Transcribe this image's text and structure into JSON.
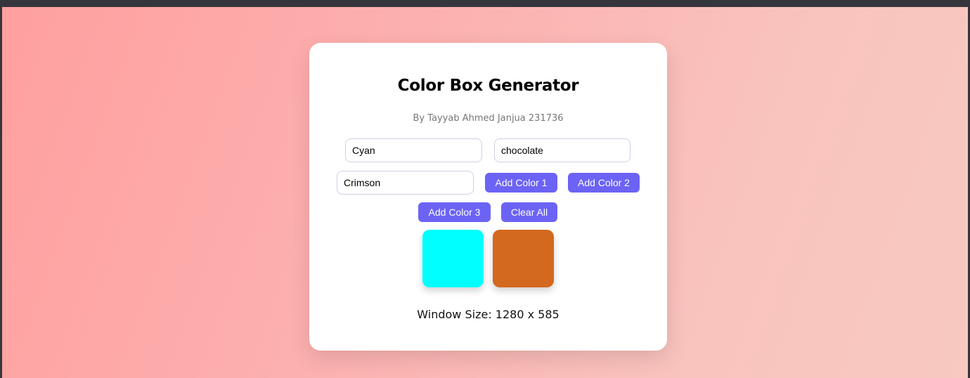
{
  "app": {
    "title": "Color Box Generator",
    "subtitle": "By Tayyab Ahmed Janjua 231736"
  },
  "inputs": {
    "color1_value": "Cyan",
    "color2_value": "chocolate",
    "color3_value": "Crimson"
  },
  "buttons": {
    "add_color_1": "Add Color 1",
    "add_color_2": "Add Color 2",
    "add_color_3": "Add Color 3",
    "clear_all": "Clear All"
  },
  "boxes": [
    {
      "color": "#00ffff"
    },
    {
      "color": "#d2691e"
    }
  ],
  "status": {
    "window_size": "Window Size: 1280 x 585"
  },
  "theme": {
    "accent": "#6c63f5",
    "card_background": "#ffffff"
  }
}
